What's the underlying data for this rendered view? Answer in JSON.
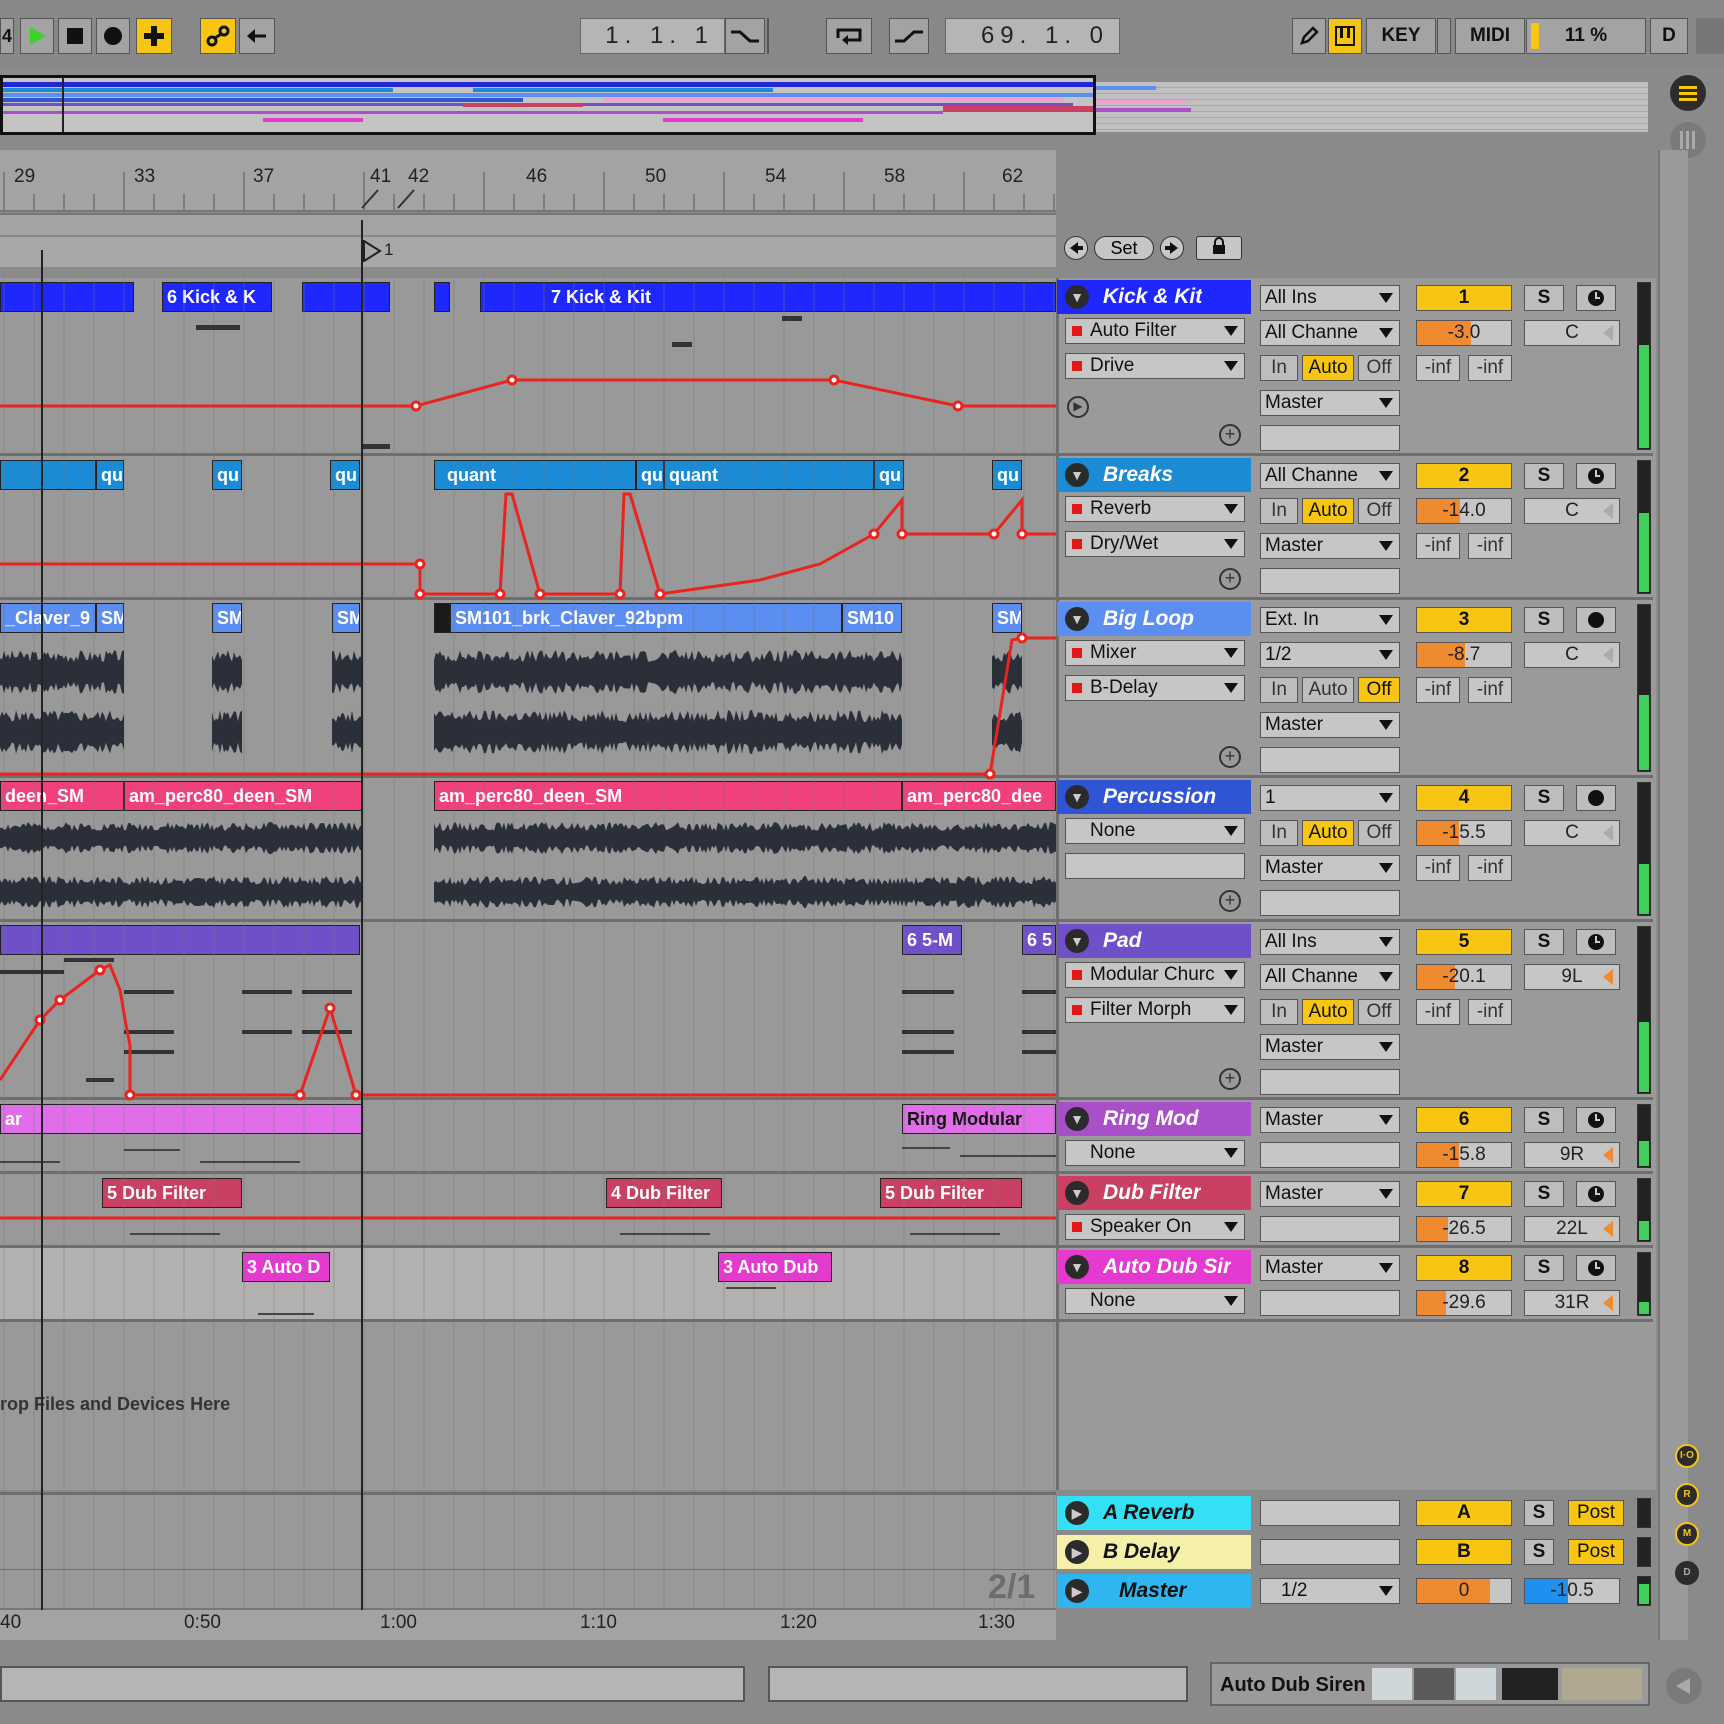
{
  "transport": {
    "partial_left": "4",
    "position": "1.   1.   1",
    "loop_end": "69.   1.   0",
    "key_label": "KEY",
    "midi_label": "MIDI",
    "cpu": "11 %",
    "d_label": "D"
  },
  "ruler": {
    "bars": [
      "29",
      "33",
      "37",
      "41",
      "42",
      "46",
      "50",
      "54",
      "58",
      "62"
    ],
    "locator": "1",
    "set_label": "Set",
    "times": [
      "40",
      "0:50",
      "1:00",
      "1:10",
      "1:20",
      "1:30"
    ]
  },
  "clips": {
    "kick_a": "6 Kick & K",
    "kick_b": "7 Kick & Kit",
    "breaks_qu": "qu",
    "breaks_quant": "quant",
    "bigloop_a": "_Claver_9",
    "bigloop_b": "SM",
    "bigloop_c": "SM101_brk_Claver_92bpm",
    "bigloop_d": "SM10",
    "perc_a": "deen_SM",
    "perc_b": "am_perc80_deen_SM",
    "perc_c": "am_perc80_deen_SM",
    "perc_d": "am_perc80_dee",
    "pad_a": "6 5-M",
    "pad_b": "6 5",
    "ring_a": "ar",
    "ring_b": "Ring Modular",
    "dub_a": "5 Dub Filter",
    "dub_b": "4 Dub Filter",
    "dub_c": "5 Dub Filter",
    "auto_a": "3 Auto D",
    "auto_b": "3 Auto Dub",
    "drop_hint": "rop Files and Devices Here"
  },
  "tracks": [
    {
      "name": "Kick & Kit",
      "color": "#1f27ff",
      "text": "#ffffff",
      "num": "1",
      "vol": "-3.0",
      "pan": "C",
      "in1": "All Ins",
      "in2": "All Channe",
      "dev1": "Auto Filter",
      "dev2": "Drive",
      "out": "Master",
      "s1": "-inf",
      "s2": "-inf",
      "mon": "Auto"
    },
    {
      "name": "Breaks",
      "color": "#1b8bd6",
      "text": "#ffffff",
      "num": "2",
      "vol": "-14.0",
      "pan": "C",
      "in1": "All Channe",
      "dev1": "Reverb",
      "dev2": "Dry/Wet",
      "out": "Master",
      "s1": "-inf",
      "s2": "-inf",
      "mon": "Auto"
    },
    {
      "name": "Big Loop",
      "color": "#5b8ef0",
      "text": "#ffffff",
      "num": "3",
      "vol": "-8.7",
      "pan": "C",
      "in1": "Ext. In",
      "in2": "1/2",
      "dev1": "Mixer",
      "dev2": "B-Delay",
      "out": "Master",
      "s1": "-inf",
      "s2": "-inf",
      "mon": "Off"
    },
    {
      "name": "Percussion",
      "color": "#2f55d4",
      "text": "#ffffff",
      "num": "4",
      "vol": "-15.5",
      "pan": "C",
      "in1": "1",
      "dev1": "None",
      "out": "Master",
      "s1": "-inf",
      "s2": "-inf",
      "mon": "Auto"
    },
    {
      "name": "Pad",
      "color": "#7050c8",
      "text": "#ffffff",
      "num": "5",
      "vol": "-20.1",
      "pan": "9L",
      "in1": "All Ins",
      "in2": "All Channe",
      "dev1": "Modular Churc",
      "dev2": "Filter Morph",
      "out": "Master",
      "s1": "-inf",
      "s2": "-inf",
      "mon": "Auto"
    },
    {
      "name": "Ring Mod",
      "color": "#a84fc9",
      "text": "#ffffff",
      "num": "6",
      "vol": "-15.8",
      "pan": "9R",
      "out": "Master",
      "dev1": "None"
    },
    {
      "name": "Dub Filter",
      "color": "#c94062",
      "text": "#ffffff",
      "num": "7",
      "vol": "-26.5",
      "pan": "22L",
      "out": "Master",
      "dev1": "Speaker On"
    },
    {
      "name": "Auto Dub Sir",
      "color": "#e53ad0",
      "text": "#ffffff",
      "num": "8",
      "vol": "-29.6",
      "pan": "31R",
      "out": "Master",
      "dev1": "None"
    }
  ],
  "monitor": {
    "in": "In",
    "auto": "Auto",
    "off": "Off"
  },
  "solo": "S",
  "returns": [
    {
      "name": "A Reverb",
      "color": "#33e0f5",
      "letter": "A",
      "post": "Post"
    },
    {
      "name": "B Delay",
      "color": "#f5f0a8",
      "letter": "B",
      "post": "Post"
    }
  ],
  "master": {
    "name": "Master",
    "color": "#2fb6f0",
    "input": "1/2",
    "vol": "0",
    "pan": "-10.5"
  },
  "time_sig": "2/1",
  "side_buttons": {
    "io": "I·O",
    "r": "R",
    "m": "M",
    "d": "D"
  },
  "status": {
    "device": "Auto Dub Siren"
  },
  "colors": {
    "accent": "#f7c512",
    "automation": "#e8241e",
    "volume": "#f08a30"
  }
}
